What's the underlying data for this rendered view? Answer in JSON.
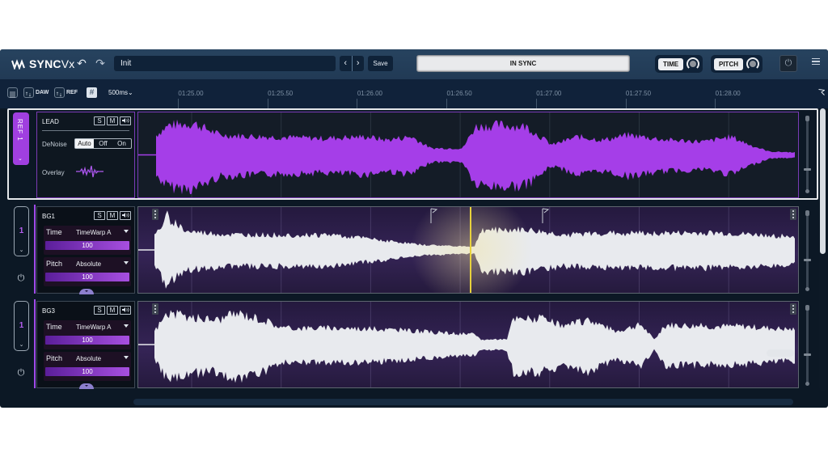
{
  "header": {
    "app_name_bold": "SYNC",
    "app_name_light": "Vx",
    "preset_name": "Init",
    "prev_label": "‹",
    "next_label": "›",
    "save_label": "Save",
    "sync_status": "IN SYNC",
    "time_label": "TIME",
    "pitch_label": "PITCH",
    "undo_icon": "↶",
    "redo_icon": "↷",
    "power_icon": "⏻"
  },
  "toolbar": {
    "daw_label": "DAW",
    "ref_label": "REF",
    "grid_icon": "#",
    "resolution": "500ms",
    "resolution_caret": "⌄",
    "ticks": [
      "01:25.00",
      "01:25.50",
      "01:26.00",
      "01:26.50",
      "01:27.00",
      "01:27.50",
      "01:28.00"
    ]
  },
  "reference": {
    "tab_label": "REF 1",
    "chevron": "⌄",
    "track_name": "LEAD",
    "solo": "S",
    "mute": "M",
    "speaker_icon": "🔈",
    "denoise_label": "DeNoise",
    "denoise_options": [
      "Auto",
      "Off",
      "On"
    ],
    "denoise_selected": "Auto",
    "overlay_label": "Overlay",
    "waveform_color": "#a53ee8"
  },
  "tracks": [
    {
      "name": "BG1",
      "ref_index": "1",
      "chevron": "⌄",
      "solo": "S",
      "mute": "M",
      "time_label": "Time",
      "time_mode": "TimeWarp A",
      "time_amount": "100",
      "time_amount_value": 100,
      "pitch_label": "Pitch",
      "pitch_mode": "Absolute",
      "pitch_amount": "100",
      "pitch_amount_value": 100,
      "power_icon": "⏻"
    },
    {
      "name": "BG3",
      "ref_index": "1",
      "chevron": "⌄",
      "solo": "S",
      "mute": "M",
      "time_label": "Time",
      "time_mode": "TimeWarp A",
      "time_amount": "100",
      "time_amount_value": 100,
      "pitch_label": "Pitch",
      "pitch_mode": "Absolute",
      "pitch_amount": "100",
      "pitch_amount_value": 100,
      "power_icon": "⏻"
    }
  ],
  "colors": {
    "accent_purple": "#a040e6",
    "playhead": "#e8d23c",
    "sync_bg": "#e9eaec",
    "bg_waveform": "#e8eaee"
  }
}
